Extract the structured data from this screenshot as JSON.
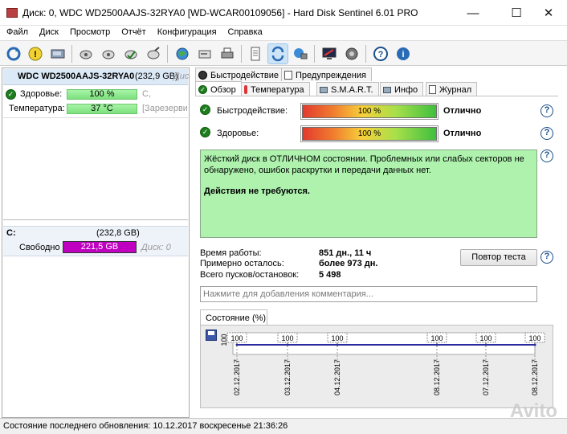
{
  "window": {
    "title": "Диск: 0, WDC WD2500AAJS-32RYA0 [WD-WCAR00109056]  -  Hard Disk Sentinel 6.01 PRO",
    "minimize": "—",
    "maximize": "☐",
    "close": "✕"
  },
  "menu": [
    "Файл",
    "Диск",
    "Просмотр",
    "Отчёт",
    "Конфигурация",
    "Справка"
  ],
  "disk": {
    "name": "WDC WD2500AAJS-32RYA0",
    "size": "(232,9 GB)",
    "disk_label": "Дис",
    "health_label": "Здоровье:",
    "health_value": "100 %",
    "health_extra": "C,",
    "temp_label": "Температура:",
    "temp_value": "37 °C",
    "temp_extra": "[Зарезерви",
    "health_percent": 100
  },
  "partition": {
    "letter": "C:",
    "size": "(232,8 GB)",
    "free_label": "Свободно",
    "free_value": "221,5 GB",
    "disk_ref": "Диск: 0"
  },
  "tabs_top": [
    "Быстродействие",
    "Предупреждения"
  ],
  "tabs_bottom": [
    "Обзор",
    "Температура",
    "S.M.A.R.T.",
    "Инфо",
    "Журнал"
  ],
  "overview": {
    "perf_label": "Быстродействие:",
    "perf_value": "100 %",
    "perf_status": "Отлично",
    "health_label": "Здоровье:",
    "health_value": "100 %",
    "health_status": "Отлично",
    "message_line1": "Жёсткий диск в ОТЛИЧНОМ состоянии. Проблемных или слабых секторов не",
    "message_line2": "обнаружено, ошибок раскрутки и передачи данных нет.",
    "message_action": "Действия не требуются.",
    "uptime_label": "Время работы:",
    "uptime_value": "851 дн., 11 ч",
    "remaining_label": "Примерно осталось:",
    "remaining_value": "более 973 дн.",
    "starts_label": "Всего пусков/остановок:",
    "starts_value": "5 498",
    "retest_button": "Повтор теста",
    "comment_placeholder": "Нажмите для добавления комментария..."
  },
  "chart_tab": "Состояние (%)",
  "chart_data": {
    "type": "line",
    "x": [
      "02.12.2017",
      "03.12.2017",
      "04.12.2017",
      "08.12.2017",
      "07.12.2017",
      "08.12.2017"
    ],
    "values": [
      100,
      100,
      100,
      100,
      100,
      100
    ],
    "y_tick": "100",
    "ylim": [
      0,
      100
    ]
  },
  "statusbar": "Состояние последнего обновления: 10.12.2017 воскресенье 21:36:26",
  "watermark": "Avito",
  "colors": {
    "health_green": "#7de07d",
    "status_green": "#aef2ae",
    "free_magenta": "#c000c0",
    "chart_line": "#2a2aa0"
  }
}
